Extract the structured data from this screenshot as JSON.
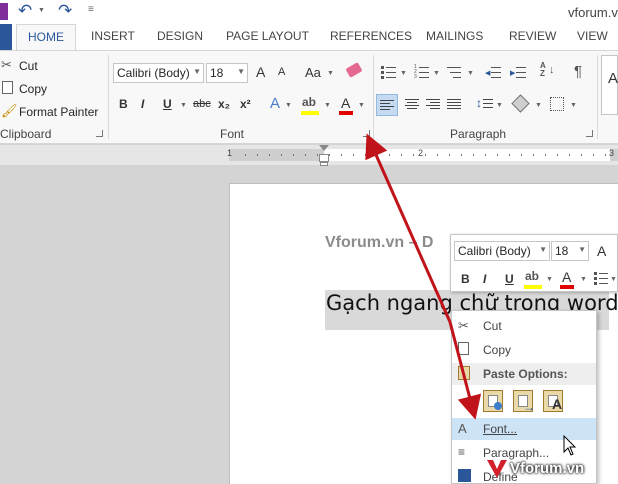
{
  "titlebar": {
    "window_title": "vforum.vn"
  },
  "tabs": {
    "file": "",
    "home": "HOME",
    "insert": "INSERT",
    "design": "DESIGN",
    "page_layout": "PAGE LAYOUT",
    "references": "REFERENCES",
    "mailings": "MAILINGS",
    "review": "REVIEW",
    "view": "VIEW"
  },
  "clipboard": {
    "cut": "Cut",
    "copy": "Copy",
    "format_painter": "Format Painter",
    "group_label": "Clipboard"
  },
  "font_group": {
    "font_name": "Calibri (Body)",
    "font_size": "18",
    "change_case": "Aa",
    "bold": "B",
    "italic": "I",
    "underline": "U",
    "strikethrough": "abc",
    "subscript": "x₂",
    "superscript": "x²",
    "grow": "A",
    "shrink": "A",
    "effects": "A",
    "font_color": "A",
    "group_label": "Font"
  },
  "paragraph_group": {
    "group_label": "Paragraph",
    "pilcrow": "¶"
  },
  "styles_group": {
    "preview": "A"
  },
  "ruler": {
    "tick_1": "1",
    "tick_2": "2",
    "tick_3": "3"
  },
  "document": {
    "heading": "Vforum.vn – D",
    "selected_text": "Gạch ngang chữ trong word"
  },
  "mini_toolbar": {
    "font_name": "Calibri (Body)",
    "font_size": "18",
    "bold": "B",
    "italic": "I",
    "underline": "U",
    "font_color": "A",
    "grow": "A"
  },
  "context_menu": {
    "cut": "Cut",
    "copy": "Copy",
    "paste_options": "Paste Options:",
    "font": "Font...",
    "paragraph": "Paragraph...",
    "define": "Define"
  },
  "watermark": {
    "text": "Vforum.vn"
  },
  "colors": {
    "accent": "#2b579a",
    "annotation_arrow": "#c0141a",
    "highlight": "#d9d9d9",
    "menu_hover": "#cde4f7",
    "font_color_bar": "#e00000",
    "highlight_bar": "#ffff00"
  }
}
